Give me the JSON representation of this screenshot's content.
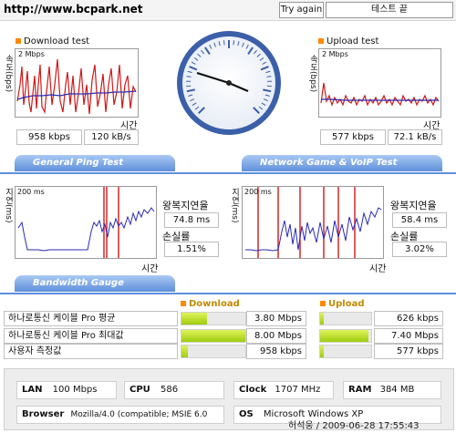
{
  "header": {
    "url": "http://www.bcpark.net",
    "try_again": "Try again",
    "status": "테스트 끝"
  },
  "download": {
    "title": "Download test",
    "ylabel": "속도(bps)",
    "ymax": "2 Mbps",
    "xlabel": "시간",
    "kbps": "958 kbps",
    "kBs": "120 kB/s"
  },
  "upload": {
    "title": "Upload test",
    "ylabel": "속도(bps)",
    "ymax": "2 Mbps",
    "xlabel": "시간",
    "kbps": "577 kbps",
    "kBs": "72.1 kB/s"
  },
  "sections": {
    "ping": "General Ping Test",
    "game": "Network Game & VoIP Test",
    "bandwidth": "Bandwidth Gauge"
  },
  "ping1": {
    "ylabel": "지연(ms)",
    "ymax": "200 ms",
    "xlabel": "시간",
    "rtt_label": "왕복지연율",
    "rtt": "74.8 ms",
    "loss_label": "손실률",
    "loss": "1.51%"
  },
  "ping2": {
    "ylabel": "지연(ms)",
    "ymax": "200 ms",
    "xlabel": "시간",
    "rtt_label": "왕복지연율",
    "rtt": "58.4 ms",
    "loss_label": "손실률",
    "loss": "3.02%"
  },
  "bandwidth": {
    "download_head": "Download",
    "upload_head": "Upload",
    "rows": [
      {
        "label": "하나로통신 케이블 Pro 평균",
        "down": "3.80 Mbps",
        "down_frac": 0.4,
        "up": "626 kbps",
        "up_frac": 0.08
      },
      {
        "label": "하나로통신 케이블 Pro 최대값",
        "down": "8.00 Mbps",
        "down_frac": 1.0,
        "up": "7.40 Mbps",
        "up_frac": 0.95
      },
      {
        "label": "사용자 측정값",
        "down": "958 kbps",
        "down_frac": 0.1,
        "up": "577 kbps",
        "up_frac": 0.07
      }
    ]
  },
  "system": {
    "lan_label": "LAN",
    "lan": "100 Mbps",
    "cpu_label": "CPU",
    "cpu": "586",
    "clock_label": "Clock",
    "clock": "1707 MHz",
    "ram_label": "RAM",
    "ram": "384 MB",
    "browser_label": "Browser",
    "browser": "Mozilla/4.0 (compatible; MSIE 6.0",
    "os_label": "OS",
    "os": "Microsoft Windows XP",
    "signature": "허석웅 / 2009-06-28 17:55:43"
  },
  "colors": {
    "accent": "#5f8fdb",
    "red": "#d01818",
    "blue": "#2a2ab5",
    "bar": "#a8d214"
  }
}
